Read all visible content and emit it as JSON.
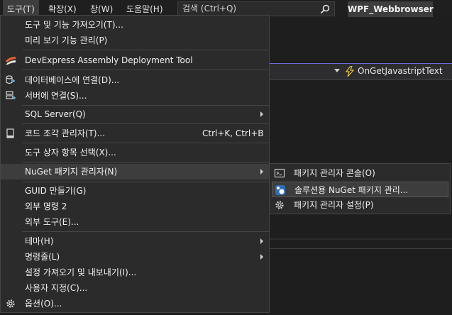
{
  "menubar": {
    "items": [
      "도구(T)",
      "확장(X)",
      "창(W)",
      "도움말(H)"
    ],
    "search_placeholder": "검색 (Ctrl+Q)",
    "project_title": "WPF_Webbrowser"
  },
  "background": {
    "event_dropdown": "OnGetJavastriptText"
  },
  "tools_menu": {
    "items": [
      {
        "label": "도구 및 기능 가져오기(T)..."
      },
      {
        "label": "미리 보기 기능 관리(P)"
      },
      {
        "label": "DevExpress Assembly Deployment Tool"
      },
      {
        "label": "데이터베이스에 연결(D)..."
      },
      {
        "label": "서버에 연결(S)..."
      },
      {
        "label": "SQL Server(Q)"
      },
      {
        "label": "코드 조각 관리자(T)...",
        "shortcut": "Ctrl+K, Ctrl+B"
      },
      {
        "label": "도구 상자 항목 선택(X)..."
      },
      {
        "label": "NuGet 패키지 관리자(N)"
      },
      {
        "label": "GUID 만들기(G)"
      },
      {
        "label": "외부 명령 2"
      },
      {
        "label": "외부 도구(E)..."
      },
      {
        "label": "테마(H)"
      },
      {
        "label": "명령줄(L)"
      },
      {
        "label": "설정 가져오기 및 내보내기(I)..."
      },
      {
        "label": "사용자 지정(C)..."
      },
      {
        "label": "옵션(O)..."
      }
    ]
  },
  "nuget_submenu": {
    "items": [
      {
        "label": "패키지 관리자 콘솔(O)"
      },
      {
        "label": "솔루션용 NuGet 패키지 관리..."
      },
      {
        "label": "패키지 관리자 설정(P)"
      }
    ]
  },
  "colors": {
    "menu_bg": "#2b2b2b",
    "highlight": "#3d3d3d",
    "accent": "#6b6bd6",
    "devexpress_orange": "#e8612c",
    "bolt_yellow": "#e8c23a"
  }
}
